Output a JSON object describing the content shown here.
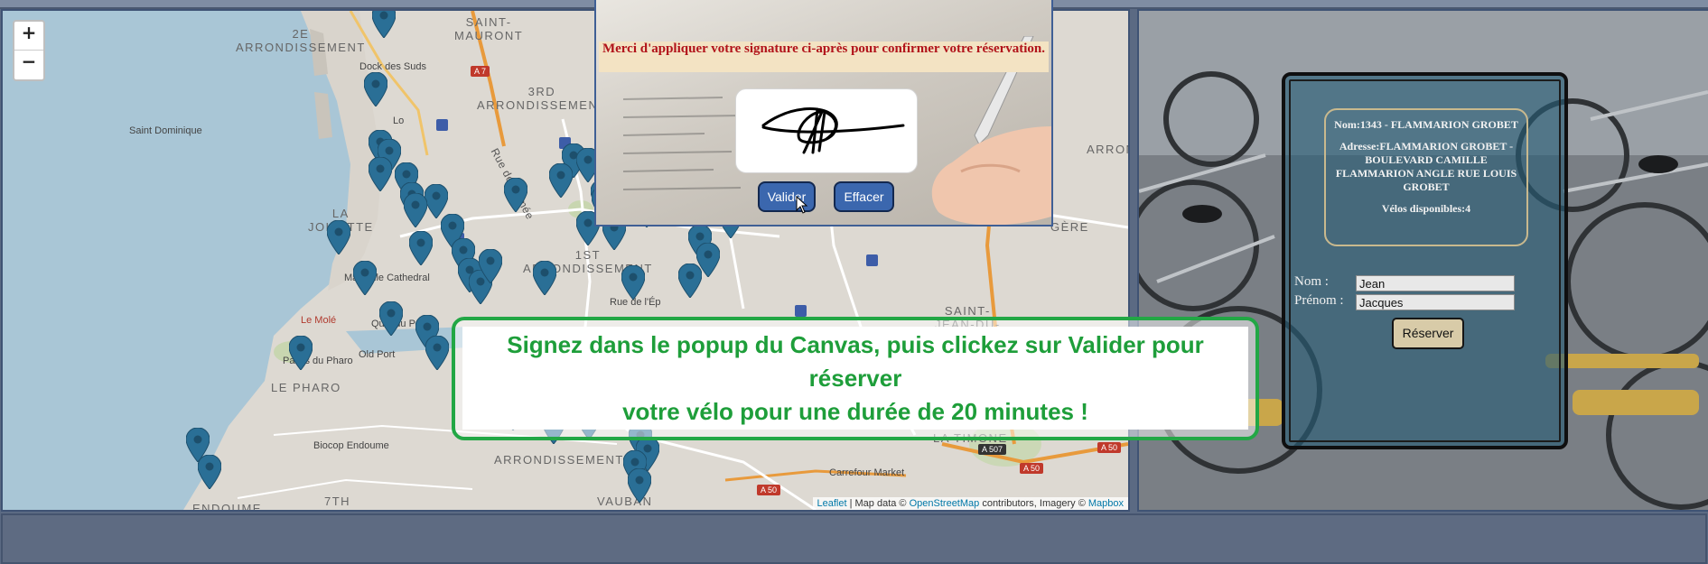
{
  "map": {
    "zoom_in": "+",
    "zoom_out": "−",
    "labels": {
      "arr2": "2E\nARRONDISSEMENT",
      "saint_mauront": "SAINT-\nMAURONT",
      "arr3": "3RD\nARRONDISSEMENT",
      "saint_dominique": "Saint Dominique",
      "dock_des_suds": "Dock des Suds",
      "la_joliette": "LA\nJOLIETTE",
      "rue_de_crimee": "Rue de Crimée",
      "arr1": "1ST\nARRONDISSEMENT",
      "marseille_cathedral": "Marseille Cathedral",
      "le_mole": "Le Molé",
      "quai_du_port": "Quai du Port",
      "old_port": "Old Port",
      "palais_du_pharo": "Palais du Pharo",
      "le_pharo": "LE PHARO",
      "biocop": "Biocop Endoume",
      "arr7": "7TH",
      "arr7b": "ARRONDISSEMENT",
      "vauban": "VAUBAN",
      "carrefour": "Carrefour Market",
      "saint_jean": "SAINT-\nJEAN-DU-",
      "arron": "ARRON",
      "gere": "GÈRE",
      "endoume": "ENDOUME",
      "timone": "LA TIMONE",
      "rue_ep": "Rue de l'Ép",
      "lo": "Lo"
    },
    "roads": {
      "a7": "A 7",
      "a507": "A 507",
      "a50": "A 50",
      "a50b": "A 50",
      "a50c": "A 50"
    },
    "attribution": {
      "leaflet": "Leaflet",
      "sep1": " | Map data © ",
      "osm": "OpenStreetMap",
      "sep2": " contributors, Imagery © ",
      "mapbox": "Mapbox"
    },
    "marker_color": "#2a6f96",
    "marker_icon": "map-marker-icon"
  },
  "popup": {
    "message": "Merci d'appliquer votre signature ci-après pour confirmer votre réservation.",
    "validate_label": "Valider",
    "clear_label": "Effacer"
  },
  "notice": {
    "line1": "Signez dans le popup du Canvas, puis clickez sur Valider pour réserver",
    "line2": "votre vélo pour une durée de 20 minutes !",
    "color": "#22a745"
  },
  "station": {
    "name": "Nom:1343 - FLAMMARION GROBET",
    "address": "Adresse:FLAMMARION GROBET - BOULEVARD CAMILLE FLAMMARION ANGLE RUE LOUIS GROBET",
    "bikes": "Vélos disponibles:4"
  },
  "form": {
    "nom_label": "Nom :",
    "nom_value": "Jean",
    "prenom_label": "Prénom :",
    "prenom_value": "Jacques",
    "reserve_label": "Réserver"
  }
}
